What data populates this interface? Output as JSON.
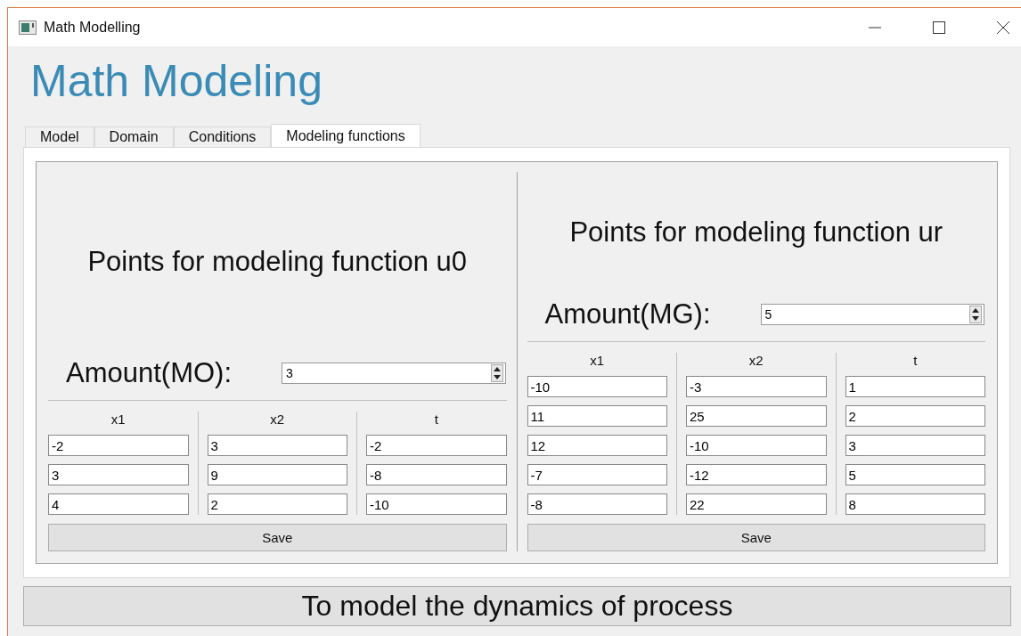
{
  "window": {
    "title": "Math Modelling"
  },
  "heading": "Math Modeling",
  "tabs": [
    {
      "label": "Model",
      "selected": false
    },
    {
      "label": "Domain",
      "selected": false
    },
    {
      "label": "Conditions",
      "selected": false
    },
    {
      "label": "Modeling functions",
      "selected": true
    }
  ],
  "panels": [
    {
      "title": "Points for modeling function u0",
      "amount_label": "Amount(MO):",
      "amount_value": "3",
      "columns": [
        "x1",
        "x2",
        "t"
      ],
      "rows": [
        [
          "-2",
          "3",
          "-2"
        ],
        [
          "3",
          "9",
          "-8"
        ],
        [
          "4",
          "2",
          "-10"
        ]
      ],
      "save": "Save"
    },
    {
      "title": "Points for modeling function ur",
      "amount_label": "Amount(MG):",
      "amount_value": "5",
      "columns": [
        "x1",
        "x2",
        "t"
      ],
      "rows": [
        [
          "-10",
          "-3",
          "1"
        ],
        [
          "11",
          "25",
          "2"
        ],
        [
          "12",
          "-10",
          "3"
        ],
        [
          "-7",
          "-12",
          "5"
        ],
        [
          "-8",
          "22",
          "8"
        ]
      ],
      "save": "Save"
    }
  ],
  "action_button": "To model the dynamics of process"
}
